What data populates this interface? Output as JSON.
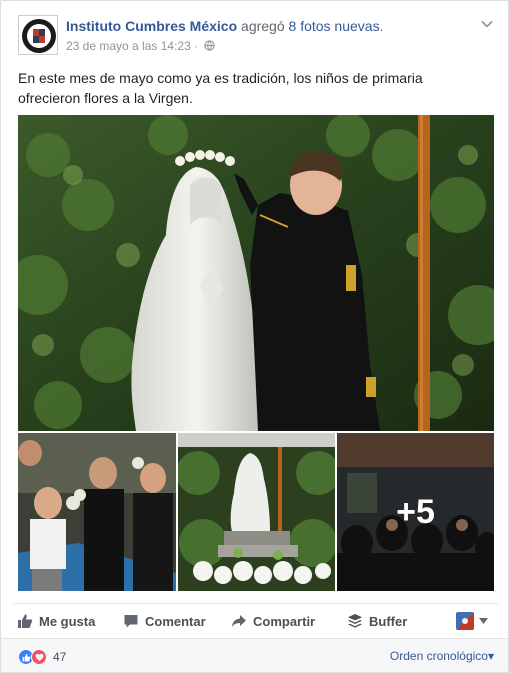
{
  "post": {
    "page_name": "Instituto Cumbres México",
    "action_verb": "agregó",
    "action_link": "8 fotos nuevas",
    "action_period": ".",
    "timestamp": "23 de mayo a las 14:23",
    "separator": "·",
    "privacy_icon": "globe-icon",
    "text": "En este mes de mayo como ya es tradición, los niños de primaria ofrecieron flores a la Virgen."
  },
  "photos": {
    "main_icon": "virgin-statue-boy-photo",
    "thumbs": [
      "children-flowers-photo",
      "statue-garden-photo",
      "crowd-photo"
    ],
    "more_count": "+5"
  },
  "actions": {
    "like": "Me gusta",
    "comment": "Comentar",
    "share": "Compartir",
    "buffer": "Buffer"
  },
  "footer": {
    "reaction_count": "47",
    "reaction_icons": [
      "like-icon",
      "love-icon"
    ],
    "order_label": "Orden cronológico",
    "order_caret": "▾"
  },
  "colors": {
    "link": "#365899",
    "like_blue": "#4080ff",
    "love_red": "#f25268",
    "meta_gray": "#90949c"
  }
}
